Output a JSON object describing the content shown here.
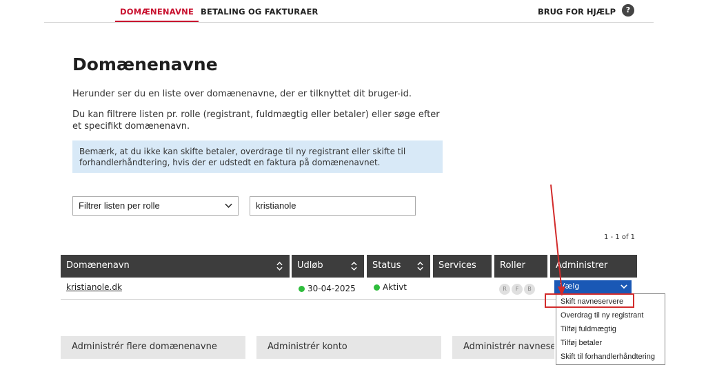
{
  "nav": {
    "tabs": [
      {
        "label": "DOMÆNENAVNE",
        "active": true
      },
      {
        "label": "BETALING OG FAKTURAER",
        "active": false
      }
    ],
    "help_label": "BRUG FOR HJÆLP",
    "help_icon": "?"
  },
  "page": {
    "title": "Domænenavne",
    "intro": "Herunder ser du en liste over domænenavne, der er tilknyttet dit bruger-id.",
    "filter_text": "Du kan filtrere listen pr. rolle (registrant, fuldmægtig eller betaler) eller søge efter et specifikt domænenavn.",
    "notice": "Bemærk, at du ikke kan skifte betaler, overdrage til ny registrant eller skifte til forhandlerhåndtering, hvis der er udstedt en faktura på domænenavnet."
  },
  "filters": {
    "role_select": "Filtrer listen per rolle",
    "search_value": "kristianole"
  },
  "pager": "1 - 1 of 1",
  "table": {
    "headers": [
      "Domænenavn",
      "Udløb",
      "Status",
      "Services",
      "Roller",
      "Administrer"
    ],
    "rows": [
      {
        "domain": "kristianole.dk",
        "expiry": "30-04-2025",
        "status": "Aktivt",
        "roles": [
          "R",
          "F",
          "B"
        ],
        "admin_select": "Vælg"
      }
    ]
  },
  "admin_menu": {
    "options": [
      "Skift navneservere",
      "Overdrag til ny registrant",
      "Tilføj fuldmægtig",
      "Tilføj betaler",
      "Skift til forhandlerhåndtering"
    ]
  },
  "bottom_buttons": [
    "Administrér flere domænenavne",
    "Administrér konto",
    "Administrér navneservere"
  ],
  "colors": {
    "accent": "#c8102e",
    "header_bg": "#3d3d3d",
    "select_blue": "#1a58b5",
    "status_green": "#2ebd3c",
    "annotation_red": "#d22b2b"
  }
}
